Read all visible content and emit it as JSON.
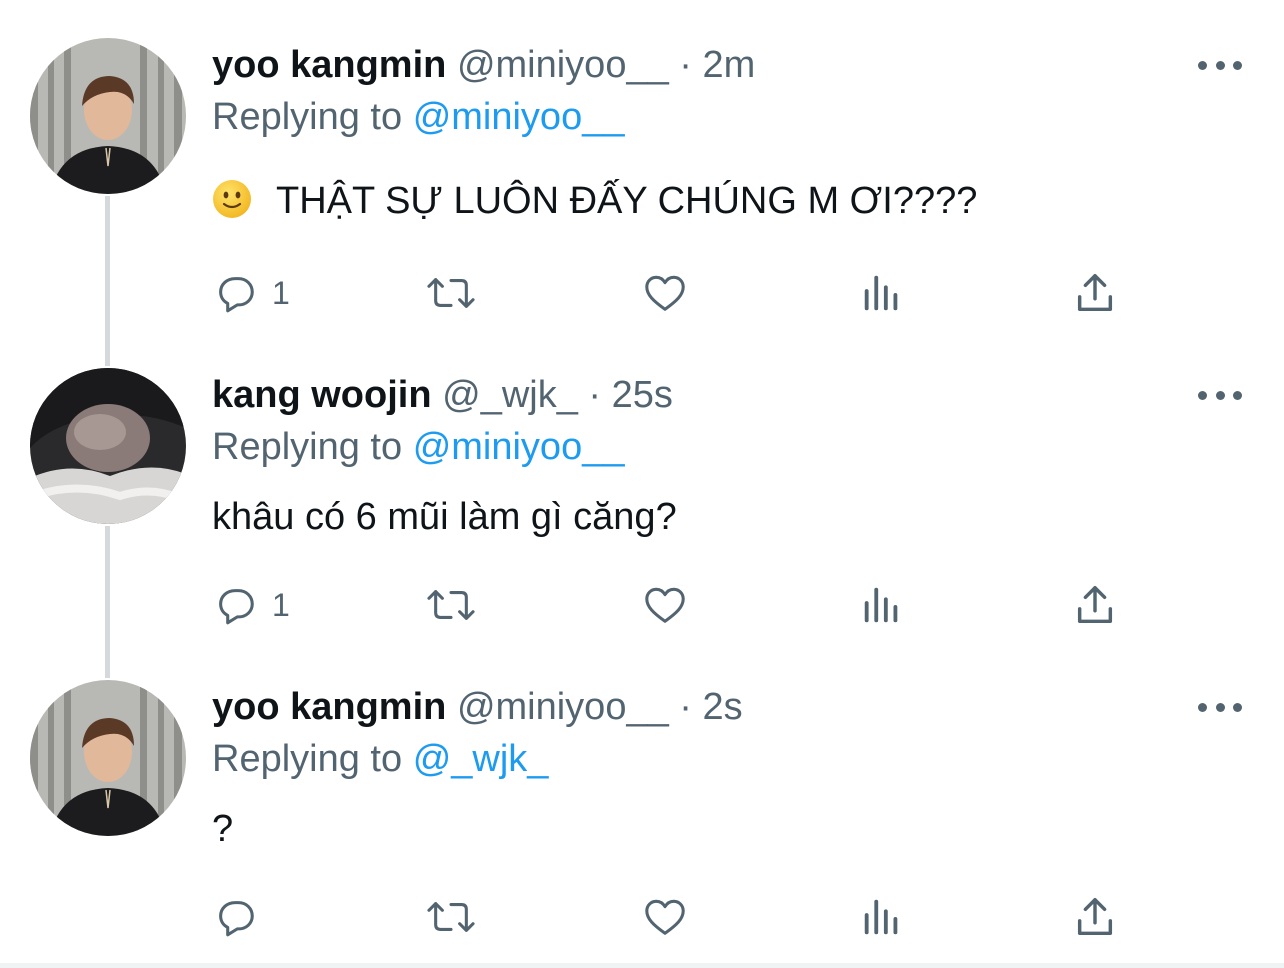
{
  "tweets": [
    {
      "name": "yoo kangmin",
      "handle": "@miniyoo__",
      "dot": "·",
      "time": "2m",
      "replying_prefix": "Replying to",
      "replying_to": "@miniyoo__",
      "text": "THẬT SỰ LUÔN ĐẤY CHÚNG M ƠI????",
      "emoji": "slightly-smiling-face",
      "reply_count": "1"
    },
    {
      "name": "kang woojin",
      "handle": "@_wjk_",
      "dot": "·",
      "time": "25s",
      "replying_prefix": "Replying to",
      "replying_to": "@miniyoo__",
      "text": "khâu có 6 mũi làm gì căng?",
      "reply_count": "1"
    },
    {
      "name": "yoo kangmin",
      "handle": "@miniyoo__",
      "dot": "·",
      "time": "2s",
      "replying_prefix": "Replying to",
      "replying_to": "@_wjk_",
      "text": "?",
      "reply_count": ""
    }
  ],
  "icons": {
    "reply": "reply-icon",
    "retweet": "retweet-icon",
    "like": "heart-icon",
    "views": "views-icon",
    "share": "share-icon",
    "more": "more-icon"
  },
  "colors": {
    "link": "#1d9bf0",
    "secondary": "#536471",
    "thread_line": "#d5d9dc"
  }
}
